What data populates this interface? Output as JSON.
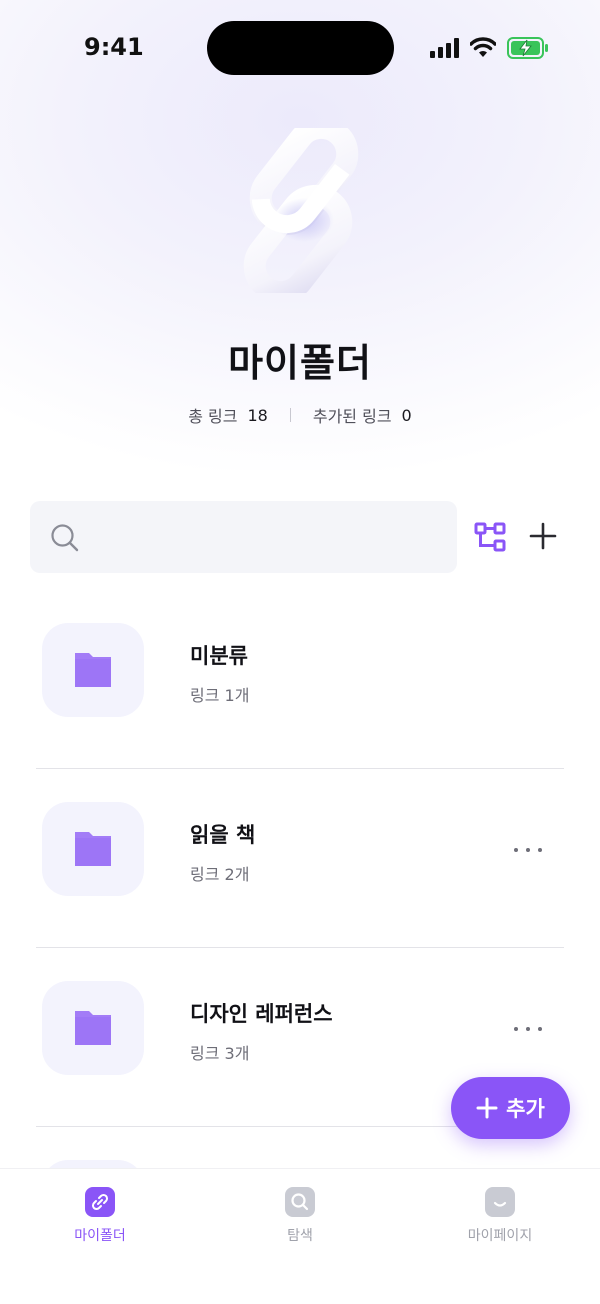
{
  "status_bar": {
    "time": "9:41",
    "battery_color": "#3ac45a"
  },
  "header": {
    "title": "마이폴더",
    "stats": [
      {
        "label": "총 링크",
        "value": "18"
      },
      {
        "label": "추가된 링크",
        "value": "0"
      }
    ]
  },
  "search": {
    "placeholder": ""
  },
  "folders": [
    {
      "name": "미분류",
      "count": "링크 1개",
      "has_more": false
    },
    {
      "name": "읽을 책",
      "count": "링크 2개",
      "has_more": true
    },
    {
      "name": "디자인 레퍼런스",
      "count": "링크 3개",
      "has_more": true
    }
  ],
  "fab": {
    "label": "추가"
  },
  "tab_bar": {
    "tabs": [
      {
        "label": "마이폴더",
        "icon": "folder-link-icon",
        "active": true
      },
      {
        "label": "탐색",
        "icon": "search-icon",
        "active": false
      },
      {
        "label": "마이페이지",
        "icon": "smile-icon",
        "active": false
      }
    ]
  },
  "colors": {
    "accent": "#8a55f7",
    "folder": "#a37cf7",
    "surface": "#f4f5f9"
  }
}
